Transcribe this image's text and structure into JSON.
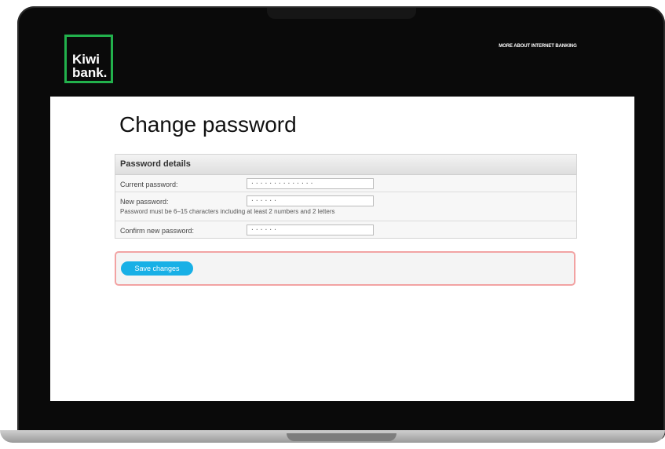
{
  "header": {
    "logo_line1": "Kiwi",
    "logo_line2": "bank.",
    "top_link": "MORE ABOUT INTERNET BANKING"
  },
  "page": {
    "title": "Change password"
  },
  "panel": {
    "title": "Password details",
    "fields": [
      {
        "label": "Current password:",
        "value": "··············"
      },
      {
        "label": "New password:",
        "value": "······",
        "hint": "Password must be 6–15 characters including at least 2 numbers and 2 letters"
      },
      {
        "label": "Confirm new password:",
        "value": "······"
      }
    ]
  },
  "actions": {
    "save_label": "Save changes"
  },
  "colors": {
    "brand_green": "#22b14c",
    "button_blue": "#18b0e6",
    "highlight": "#f2a3a3"
  }
}
